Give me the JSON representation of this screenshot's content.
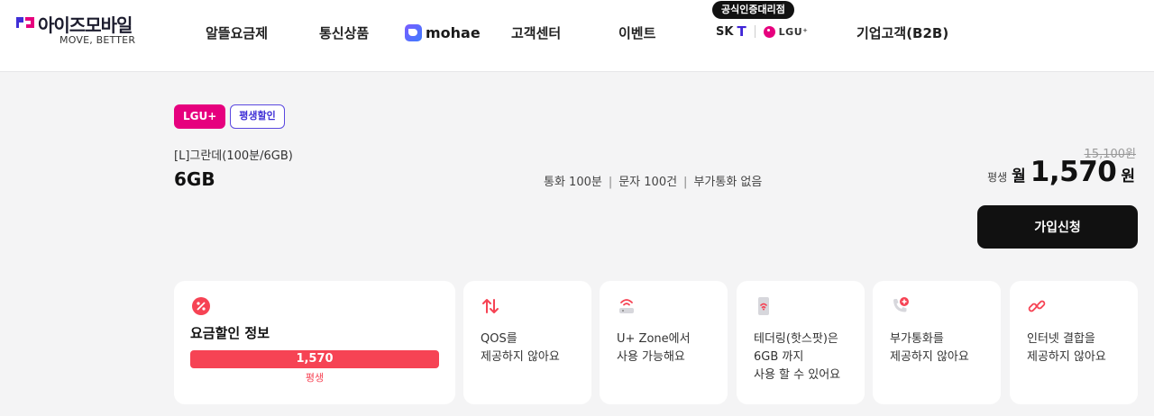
{
  "header": {
    "logo_text": "아이즈모바일",
    "logo_tagline": "MOVE, BETTER",
    "nav": [
      {
        "label": "알뜰요금제"
      },
      {
        "label": "통신상품"
      },
      {
        "label": "mohae"
      },
      {
        "label": "고객센터"
      },
      {
        "label": "이벤트"
      },
      {
        "label": "기업고객(B2B)"
      }
    ],
    "official_badge": "공식인증대리점",
    "carriers": {
      "sk": "SK",
      "lgu": "LGU⁺"
    }
  },
  "plan": {
    "tags": [
      "LGU+",
      "평생할인"
    ],
    "name": "[L]그란데(100분/6GB)",
    "data": "6GB",
    "features": [
      "통화 100분",
      "문자 100건",
      "부가통화 없음"
    ],
    "original_price": "15,100원",
    "price_period": "평생",
    "price_month": "월",
    "price_amount": "1,570",
    "price_unit": "원",
    "join_label": "가입신청"
  },
  "cards": {
    "discount": {
      "title": "요금할인 정보",
      "amount": "1,570",
      "period": "평생"
    },
    "qos": {
      "icon": "arrows-updown-icon",
      "text": "QOS를\n제공하지 않아요"
    },
    "uzone": {
      "icon": "wifi-router-icon",
      "text": "U+ Zone에서\n사용 가능해요"
    },
    "tethering": {
      "icon": "phone-hotspot-icon",
      "text": "테더링(핫스팟)은\n6GB 까지\n사용 할 수 있어요"
    },
    "extra_call": {
      "icon": "phone-plus-icon",
      "text": "부가통화를\n제공하지 않아요"
    },
    "internet": {
      "icon": "link-icon",
      "text": "인터넷 결합을\n제공하지 않아요"
    }
  },
  "colors": {
    "accent_red": "#f64354",
    "lgu_pink": "#e6007e",
    "brand_purple": "#5a48e0"
  }
}
